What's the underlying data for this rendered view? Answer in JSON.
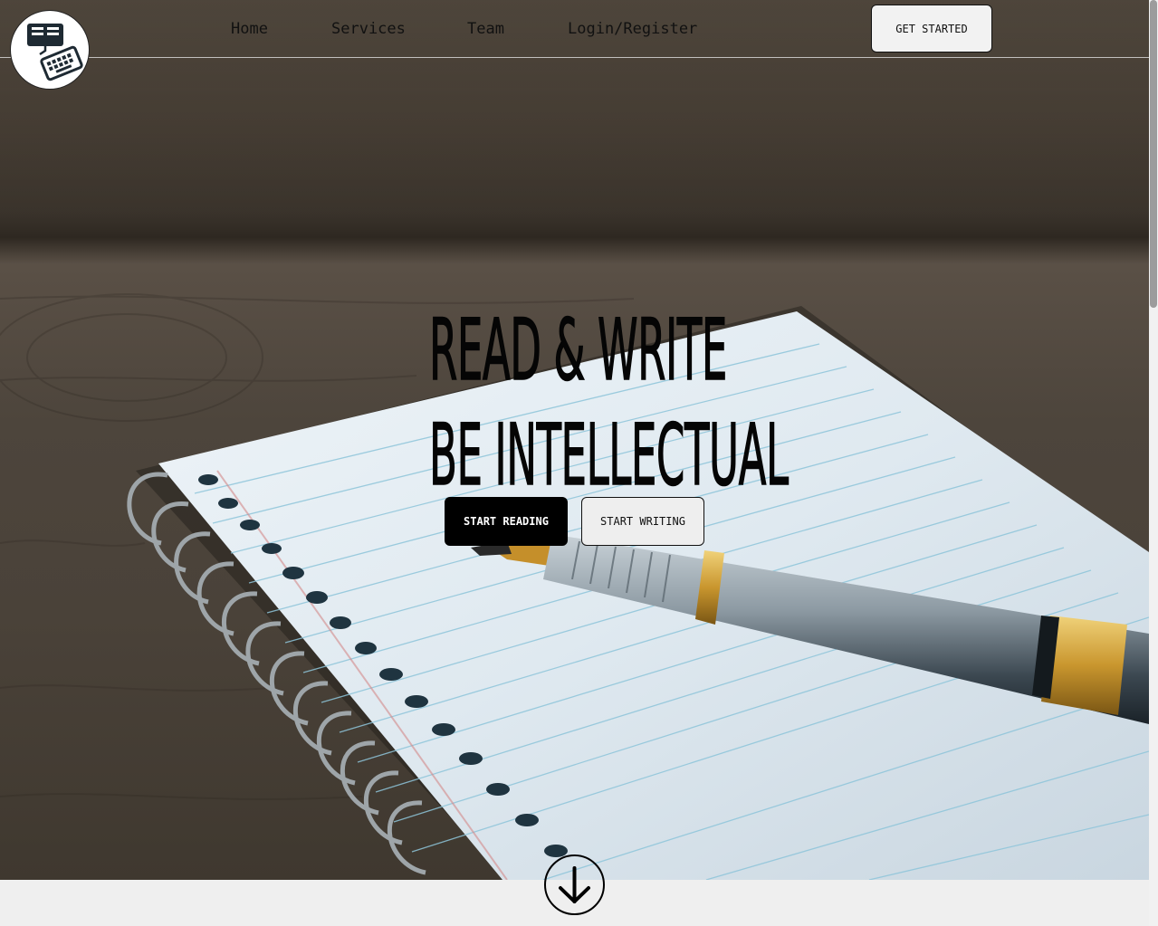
{
  "nav": {
    "links": [
      {
        "label": "Home"
      },
      {
        "label": "Services"
      },
      {
        "label": "Team"
      },
      {
        "label": "Login/Register"
      }
    ],
    "cta_label": "GET STARTED"
  },
  "logo": {
    "icon": "book-keyboard-logo-icon"
  },
  "hero": {
    "line1": "READ & WRITE",
    "line2": "BE INTELLECTUAL",
    "primary_button": "START READING",
    "secondary_button": "START WRITING",
    "scroll_icon": "arrow-down-circle-icon"
  },
  "colors": {
    "primary_button_bg": "#000000",
    "secondary_button_bg": "#eeeeee",
    "footer_strip": "#efefef"
  }
}
